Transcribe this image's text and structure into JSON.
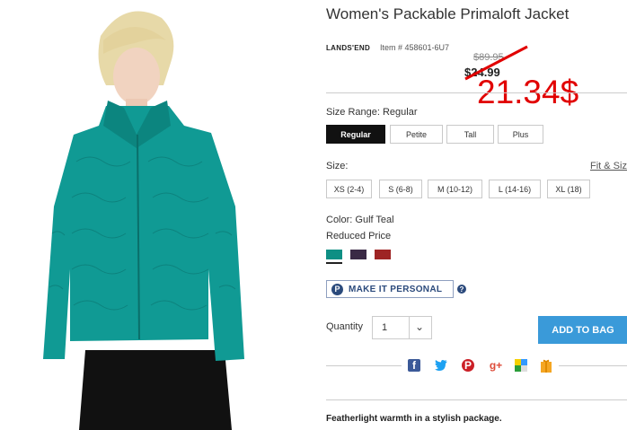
{
  "product": {
    "title": "Women's Packable Primaloft Jacket",
    "brand": "LANDS'END",
    "item_number": "Item # 458601-6U7",
    "original_price": "$89.95",
    "sale_price": "$24.99",
    "annotated_price": "21.34$"
  },
  "size_range": {
    "label": "Size Range: Regular",
    "options": [
      "Regular",
      "Petite",
      "Tall",
      "Plus"
    ],
    "selected": "Regular"
  },
  "size": {
    "label": "Size:",
    "fit_link": "Fit & Size",
    "options": [
      "XS (2-4)",
      "S (6-8)",
      "M (10-12)",
      "L (14-16)",
      "XL (18)"
    ]
  },
  "color": {
    "label": "Color: Gulf Teal",
    "price_note": "Reduced Price",
    "swatches": [
      "#0e8f84",
      "#3a2a45",
      "#9e2424"
    ]
  },
  "personalize": {
    "icon_letter": "P",
    "label": "MAKE IT PERSONAL",
    "help_glyph": "?"
  },
  "quantity": {
    "label": "Quantity",
    "value": "1"
  },
  "add_to_bag": "ADD TO BAG",
  "social": {
    "facebook": "f",
    "twitter": "🐦",
    "pinterest": "P",
    "google_plus": "g+",
    "colors": {
      "facebook": "#3b5998",
      "twitter": "#1da1f2",
      "pinterest": "#cb2027",
      "google_plus": "#dd4b39",
      "delicious": "#3399ff",
      "gift": "#f5a623"
    }
  },
  "tagline": "Featherlight warmth in a stylish package."
}
